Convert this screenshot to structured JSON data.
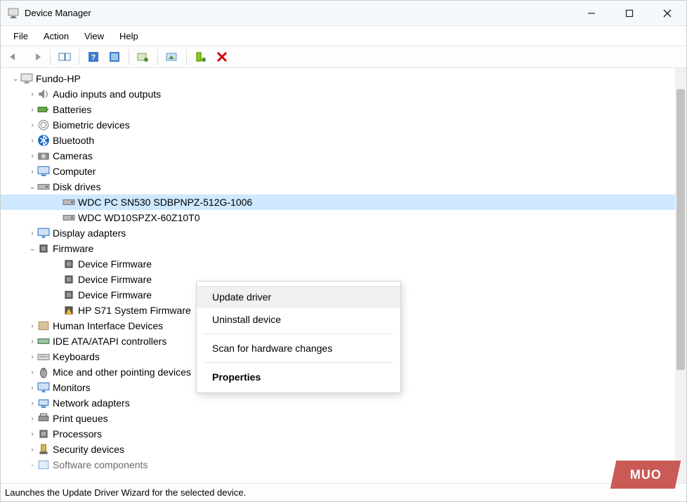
{
  "window": {
    "title": "Device Manager"
  },
  "menu": {
    "file": "File",
    "action": "Action",
    "view": "View",
    "help": "Help"
  },
  "tree": {
    "root": "Fundo-HP",
    "audio": "Audio inputs and outputs",
    "batteries": "Batteries",
    "biometric": "Biometric devices",
    "bluetooth": "Bluetooth",
    "cameras": "Cameras",
    "computer": "Computer",
    "disk": "Disk drives",
    "diskchild1": "WDC PC SN530 SDBPNPZ-512G-1006",
    "diskchild2": "WDC WD10SPZX-60Z10T0",
    "display": "Display adapters",
    "firmware": "Firmware",
    "fwchild1": "Device Firmware",
    "fwchild2": "Device Firmware",
    "fwchild3": "Device Firmware",
    "fwchild4": "HP S71 System Firmware",
    "hid": "Human Interface Devices",
    "ide": "IDE ATA/ATAPI controllers",
    "keyboards": "Keyboards",
    "mice": "Mice and other pointing devices",
    "monitors": "Monitors",
    "network": "Network adapters",
    "print": "Print queues",
    "processors": "Processors",
    "security": "Security devices",
    "software": "Software components"
  },
  "context_menu": {
    "update": "Update driver",
    "uninstall": "Uninstall device",
    "scan": "Scan for hardware changes",
    "properties": "Properties"
  },
  "status": "Launches the Update Driver Wizard for the selected device.",
  "watermark": "MUO"
}
